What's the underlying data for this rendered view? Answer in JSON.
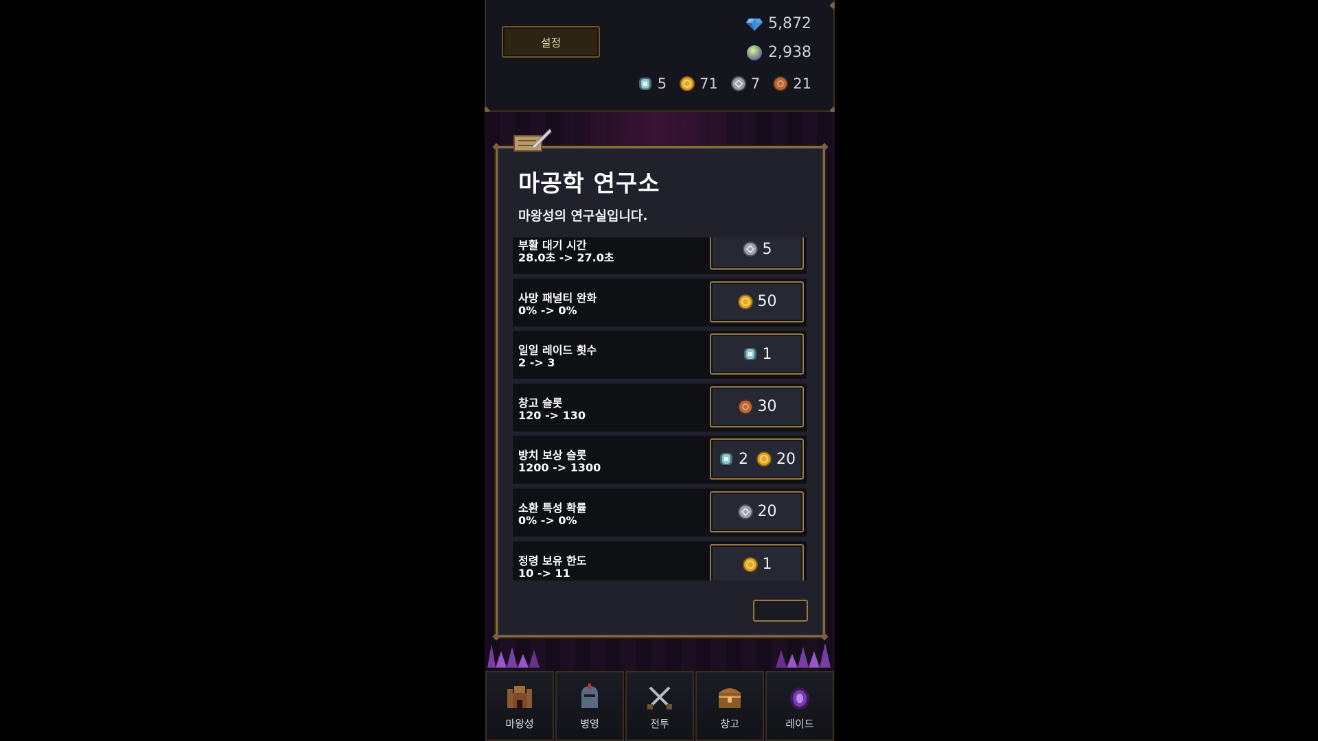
{
  "header": {
    "settings_label": "설정",
    "gems": "5,872",
    "orbs": "2,938",
    "resources": [
      {
        "icon": "spirit-stone-icon",
        "count": "5"
      },
      {
        "icon": "gold-coin-icon",
        "count": "71"
      },
      {
        "icon": "silver-coin-icon",
        "count": "7"
      },
      {
        "icon": "bronze-coin-icon",
        "count": "21"
      }
    ]
  },
  "modal": {
    "title": "마공학 연구소",
    "subtitle": "마왕성의 연구실입니다.",
    "items": [
      {
        "name": "부활 대기 시간",
        "value": "28.0초 -> 27.0초",
        "costs": [
          {
            "icon": "silver-coin-icon",
            "amount": "5"
          }
        ]
      },
      {
        "name": "사망 패널티 완화",
        "value": "0% -> 0%",
        "costs": [
          {
            "icon": "gold-coin-icon",
            "amount": "50"
          }
        ]
      },
      {
        "name": "일일 레이드 횟수",
        "value": "2 -> 3",
        "costs": [
          {
            "icon": "spirit-stone-icon",
            "amount": "1"
          }
        ]
      },
      {
        "name": "창고 슬롯",
        "value": "120 -> 130",
        "costs": [
          {
            "icon": "bronze-coin-icon",
            "amount": "30"
          }
        ]
      },
      {
        "name": "방치 보상 슬롯",
        "value": "1200 -> 1300",
        "costs": [
          {
            "icon": "spirit-stone-icon",
            "amount": "2"
          },
          {
            "icon": "gold-coin-icon",
            "amount": "20"
          }
        ]
      },
      {
        "name": "소환 특성 확률",
        "value": "0% -> 0%",
        "costs": [
          {
            "icon": "silver-coin-icon",
            "amount": "20"
          }
        ]
      },
      {
        "name": "정령 보유 한도",
        "value": "10 -> 11",
        "costs": [
          {
            "icon": "gold-coin-icon",
            "amount": "1"
          }
        ]
      }
    ]
  },
  "nav": [
    {
      "label": "마왕성",
      "icon": "demon-castle-icon"
    },
    {
      "label": "병영",
      "icon": "helmet-icon"
    },
    {
      "label": "전투",
      "icon": "crossed-swords-icon"
    },
    {
      "label": "창고",
      "icon": "chest-icon"
    },
    {
      "label": "레이드",
      "icon": "portal-icon"
    }
  ],
  "colors": {
    "gold": "#e0a82a",
    "silver": "#9aa0aa",
    "bronze": "#b8683a",
    "spirit": "#8fc8d0",
    "border": "#9a7742"
  }
}
